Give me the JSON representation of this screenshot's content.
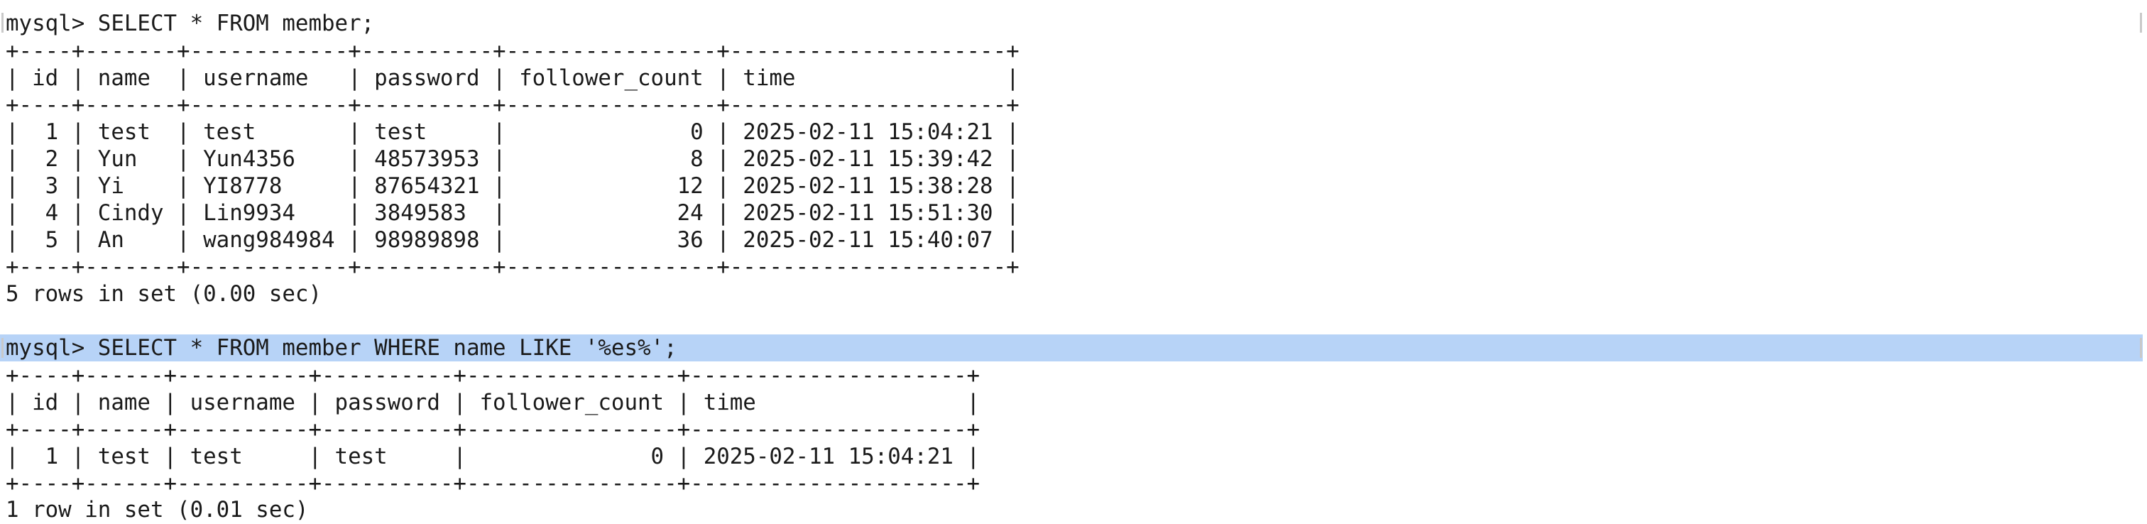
{
  "colors": {
    "background": "#ffffff",
    "text": "#1a1a1a",
    "selection_highlight": "#b7d3f7"
  },
  "session": {
    "query1": {
      "prompt_command": "mysql> SELECT * FROM member;",
      "lines": [
        "+----+-------+------------+----------+----------------+---------------------+",
        "| id | name  | username   | password | follower_count | time                |",
        "+----+-------+------------+----------+----------------+---------------------+",
        "|  1 | test  | test       | test     |              0 | 2025-02-11 15:04:21 |",
        "|  2 | Yun   | Yun4356    | 48573953 |              8 | 2025-02-11 15:39:42 |",
        "|  3 | Yi    | YI8778     | 87654321 |             12 | 2025-02-11 15:38:28 |",
        "|  4 | Cindy | Lin9934    | 3849583  |             24 | 2025-02-11 15:51:30 |",
        "|  5 | An    | wang984984 | 98989898 |             36 | 2025-02-11 15:40:07 |",
        "+----+-------+------------+----------+----------------+---------------------+"
      ],
      "summary": "5 rows in set (0.00 sec)"
    },
    "query2": {
      "prompt_command": "mysql> SELECT * FROM member WHERE name LIKE '%es%';",
      "lines": [
        "+----+------+----------+----------+----------------+---------------------+",
        "| id | name | username | password | follower_count | time                |",
        "+----+------+----------+----------+----------------+---------------------+",
        "|  1 | test | test     | test     |              0 | 2025-02-11 15:04:21 |",
        "+----+------+----------+----------+----------------+---------------------+"
      ],
      "summary": "1 row in set (0.01 sec)"
    }
  }
}
